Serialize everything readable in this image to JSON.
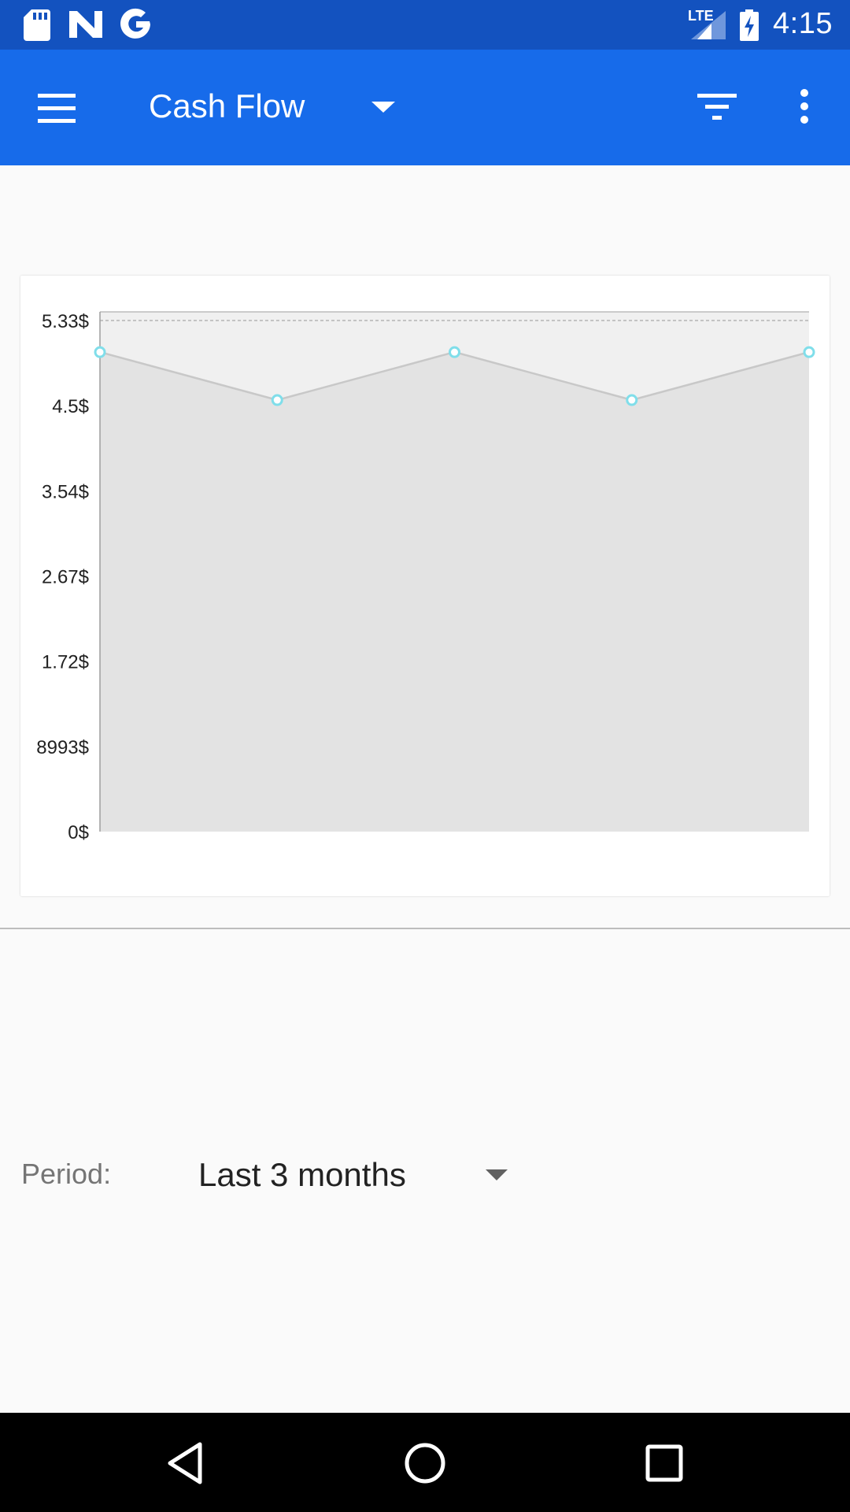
{
  "status_bar": {
    "time": "4:15",
    "network": "LTE",
    "icons": [
      "sd-card-icon",
      "n-notification-icon",
      "google-icon",
      "lte-signal-icon",
      "battery-charging-icon"
    ]
  },
  "app_bar": {
    "title": "Cash Flow",
    "icons": [
      "menu-icon",
      "dropdown-caret-icon",
      "filter-icon",
      "more-vert-icon"
    ]
  },
  "chart_data": {
    "type": "area",
    "title": "",
    "xlabel": "",
    "ylabel": "",
    "y_ticks": [
      "0$",
      "8993$",
      "1.72$",
      "2.67$",
      "3.54$",
      "4.5$",
      "5.33$"
    ],
    "x": [
      1,
      2,
      3,
      4,
      5
    ],
    "series": [
      {
        "values": [
          5.0,
          4.5,
          5.0,
          4.5,
          5.0
        ]
      }
    ],
    "ylim": [
      0,
      5.42
    ],
    "grid": true,
    "colors": {
      "area": "#e3e3e3",
      "line": "#c8c8c8",
      "marker": "#80deea"
    }
  },
  "period": {
    "label": "Period:",
    "value": "Last 3 months"
  },
  "nav_bar": {
    "icons": [
      "back-icon",
      "home-icon",
      "recents-icon"
    ]
  }
}
